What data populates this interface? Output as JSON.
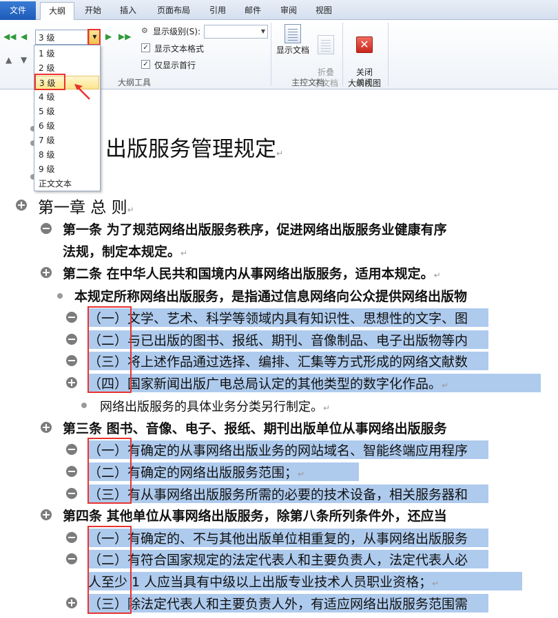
{
  "tabs": [
    "文件",
    "大纲",
    "开始",
    "插入",
    "页面布局",
    "引用",
    "邮件",
    "审阅",
    "视图"
  ],
  "toolbar": {
    "level_value": "3 级",
    "show_level_label": "显示级别(S):",
    "show_text_format": "显示文本格式",
    "show_first_line_only": "仅显示首行",
    "outline_tools_label": "大纲工具",
    "show_document": "显示文档",
    "collapse_subdoc": "折叠\n子文档",
    "master_doc_label": "主控文档",
    "close_outline": "关闭\n大纲视图",
    "close_label": "关闭"
  },
  "level_options": [
    "1 级",
    "2 级",
    "3 级",
    "4 级",
    "5 级",
    "6 级",
    "7 级",
    "8 级",
    "9 级",
    "正文文本"
  ],
  "selected_level_index": 2,
  "document": {
    "title": "出版服务管理规定",
    "chapter1": "第一章 总 则",
    "art1_l1": "第一条 为了规范网络出版服务秩序，促进网络出版服务业健康有序",
    "art1_l2": "法规，制定本规定。",
    "art2": "第二条 在中华人民共和国境内从事网络出版服务，适用本规定。",
    "def": "本规定所称网络出版服务，是指通过信息网络向公众提供网络出版物",
    "art2_items": [
      {
        "num": "（一）",
        "text": "文学、艺术、科学等领域内具有知识性、思想性的文字、图"
      },
      {
        "num": "（二）",
        "text": "与已出版的图书、报纸、期刊、音像制品、电子出版物等内"
      },
      {
        "num": "（三）",
        "text": "将上述作品通过选择、编排、汇集等方式形成的网络文献数"
      },
      {
        "num": "（四）",
        "text": "国家新闻出版广电总局认定的其他类型的数字化作品。"
      }
    ],
    "classify": "网络出版服务的具体业务分类另行制定。",
    "art3": "第三条 图书、音像、电子、报纸、期刊出版单位从事网络出版服务",
    "art3_items": [
      {
        "num": "（一）",
        "text": "有确定的从事网络出版业务的网站域名、智能终端应用程序"
      },
      {
        "num": "（二）",
        "text": "有确定的网络出版服务范围；"
      },
      {
        "num": "（三）",
        "text": "有从事网络出版服务所需的必要的技术设备，相关服务器和"
      }
    ],
    "art4": "第四条 其他单位从事网络出版服务，除第八条所列条件外，还应当",
    "art4_items": [
      {
        "num": "（一）",
        "text": "有确定的、不与其他出版单位相重复的，从事网络出版服务"
      },
      {
        "num": "（二）",
        "text": "有符合国家规定的法定代表人和主要负责人，法定代表人必"
      }
    ],
    "art4_cont": "人至少 1 人应当具有中级以上出版专业技术人员职业资格；",
    "art4_item3": {
      "num": "（三）",
      "text": "除法定代表人和主要负责人外，有适应网络出版服务范围需"
    }
  }
}
